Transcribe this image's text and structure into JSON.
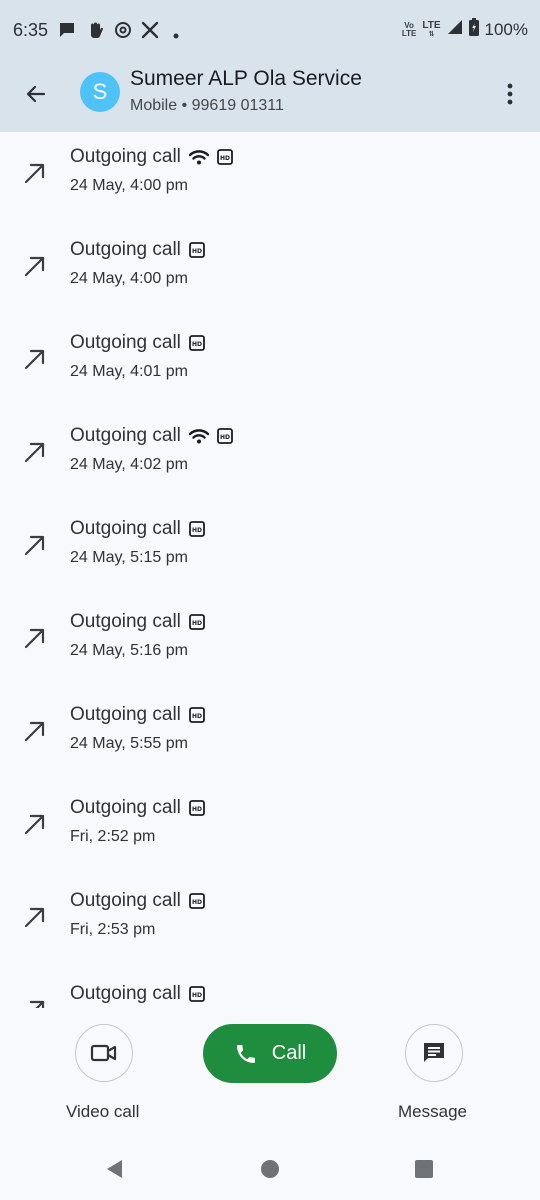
{
  "status_bar": {
    "time": "6:35",
    "notification_icons": [
      "chat-bubble-icon",
      "hand-icon",
      "threads-icon",
      "x-icon",
      "dot-icon"
    ],
    "volte_top": "Vo",
    "volte_bottom": "LTE",
    "lte": "LTE",
    "battery": "100%"
  },
  "header": {
    "avatar_letter": "S",
    "avatar_color": "#4fc3f7",
    "contact_name": "Sumeer ALP Ola Service",
    "contact_subtitle": "Mobile • 99619 01311"
  },
  "calls": [
    {
      "type": "Outgoing call",
      "time": "24 May, 4:00 pm",
      "wifi": true,
      "hd": "HD"
    },
    {
      "type": "Outgoing call",
      "time": "24 May, 4:00 pm",
      "wifi": false,
      "hd": "HD"
    },
    {
      "type": "Outgoing call",
      "time": "24 May, 4:01 pm",
      "wifi": false,
      "hd": "HD"
    },
    {
      "type": "Outgoing call",
      "time": "24 May, 4:02 pm",
      "wifi": true,
      "hd": "HD"
    },
    {
      "type": "Outgoing call",
      "time": "24 May, 5:15 pm",
      "wifi": false,
      "hd": "HD"
    },
    {
      "type": "Outgoing call",
      "time": "24 May, 5:16 pm",
      "wifi": false,
      "hd": "HD"
    },
    {
      "type": "Outgoing call",
      "time": "24 May, 5:55 pm",
      "wifi": false,
      "hd": "HD"
    },
    {
      "type": "Outgoing call",
      "time": "Fri, 2:52 pm",
      "wifi": false,
      "hd": "HD"
    },
    {
      "type": "Outgoing call",
      "time": "Fri, 2:53 pm",
      "wifi": false,
      "hd": "HD"
    },
    {
      "type": "Outgoing call",
      "time": "",
      "wifi": false,
      "hd": "HD"
    }
  ],
  "actions": {
    "video_call_label": "Video call",
    "call_label": "Call",
    "message_label": "Message",
    "call_color": "#1e8e3e"
  },
  "nav": {
    "icons": [
      "back-triangle-icon",
      "home-circle-icon",
      "recents-square-icon"
    ]
  }
}
